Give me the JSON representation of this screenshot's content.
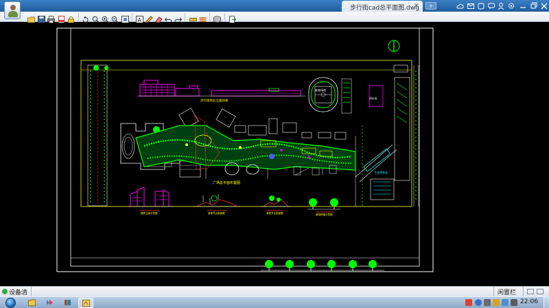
{
  "window": {
    "tab_title": "步行街cad总平面图.dwg",
    "tab_close": "✕",
    "new_tab": "+"
  },
  "toolbar": {
    "tools": [
      "open-folder-icon",
      "save-icon",
      "print-icon",
      "export-pdf-icon",
      "lock-icon",
      "rotate-icon",
      "zoom-window-icon",
      "zoom-in-icon",
      "zoom-out-icon",
      "fit-window-icon",
      "text-icon",
      "pen-icon",
      "eraser-icon",
      "undo-icon",
      "redo-icon",
      "measure-icon",
      "layers-icon",
      "compare-icon",
      "stack-icon",
      "exit-icon"
    ]
  },
  "drawing": {
    "label_elevation": "步行街商业立面效果",
    "label_stadium": "体育场地",
    "label_parking": "停车场",
    "label_plaza_plan": "广场总平面布置图",
    "label_parking_lot": "生态停车场",
    "label_section_1": "建筑立面示意图",
    "label_section_2": "景观节点剖面图",
    "label_section_3": "景观节点剖面图",
    "label_section_4": "植物种植示意图",
    "colors": {
      "white": "#ffffff",
      "magenta": "#ff00ff",
      "green": "#00ff00",
      "yellow": "#ffff00",
      "cyan": "#00ffff",
      "red": "#ff3030",
      "blue": "#4060ff"
    }
  },
  "statusbar": {
    "left_label": "设备清单",
    "right_label": "闲置栏"
  },
  "taskbar": {
    "clock": "22:06",
    "apps": [
      "explorer-icon",
      "media-icon",
      "books-icon",
      "cad-viewer-icon"
    ],
    "tray": [
      "sogou-icon",
      "help-icon",
      "network-icon",
      "flag-icon",
      "mail-icon",
      "volume-icon",
      "battery-icon"
    ]
  }
}
